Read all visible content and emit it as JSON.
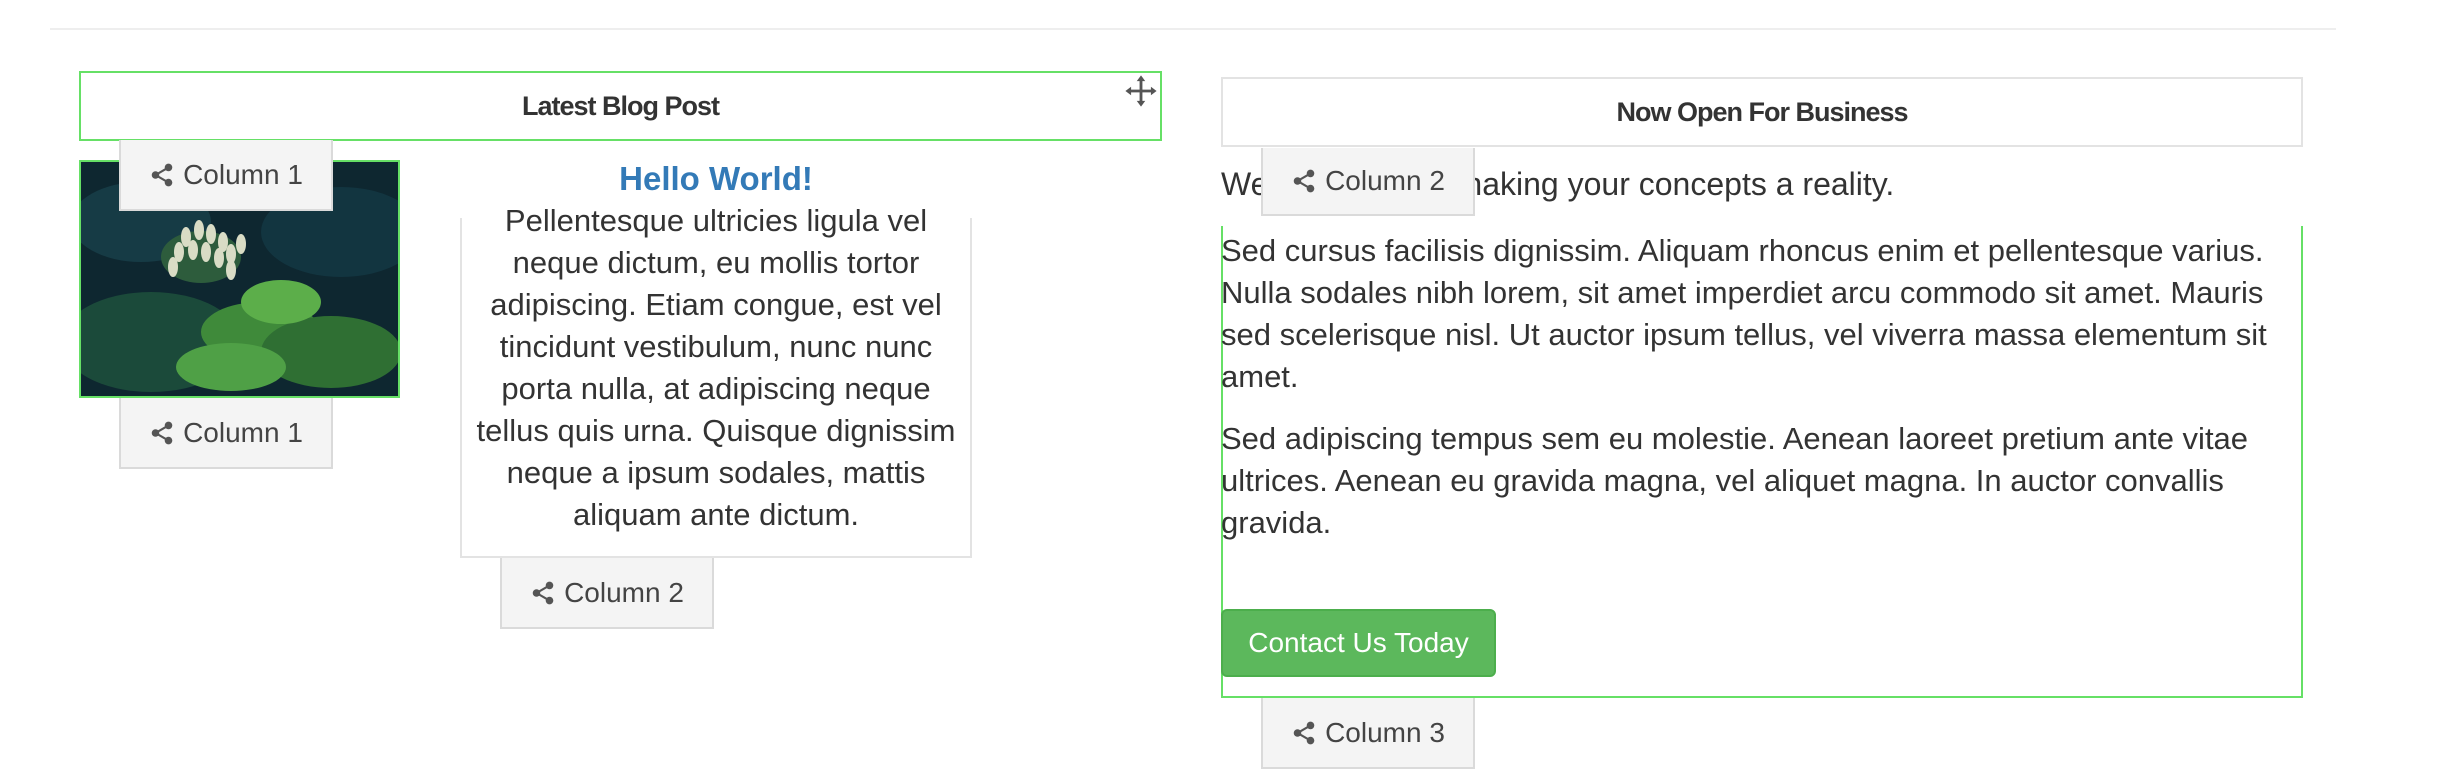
{
  "blog_panel": {
    "header_title": "Latest Blog Post",
    "post_title": "Hello World!",
    "post_body": "Pellentesque ultricies ligula vel neque dictum, eu mollis tortor adipiscing. Etiam congue, est vel tincidunt vestibulum, nunc nunc porta nulla, at adipiscing neque tellus quis urna. Quisque dignissim neque a ipsum sodales, mattis aliquam ante dictum."
  },
  "business_panel": {
    "header_title": "Now Open For Business",
    "intro_start": "We",
    "intro_end": "naking your concepts a reality.",
    "paragraph_1": "Sed cursus facilisis dignissim. Aliquam rhoncus enim et pellentesque varius. Nulla sodales nibh lorem, sit amet imperdiet arcu commodo sit amet. Mauris sed scelerisque nisl. Ut auctor ipsum tellus, vel viverra massa elementum sit amet.",
    "paragraph_2": "Sed adipiscing tempus sem eu molestie. Aenean laoreet pretium ante vitae ultrices. Aenean eu gravida magna, vel aliquet magna. In auctor convallis gravida.",
    "cta_label": "Contact Us Today"
  },
  "column_tabs": {
    "image_top": "Column 1",
    "image_bottom": "Column 1",
    "blog_text": "Column 2",
    "intro": "Column 2",
    "business_bottom": "Column 3"
  },
  "icons": {
    "move": "move-icon",
    "share": "share-icon"
  },
  "colors": {
    "selection_outline": "#66e066",
    "link_blue": "#337ab7",
    "button_green": "#5cb85c"
  }
}
